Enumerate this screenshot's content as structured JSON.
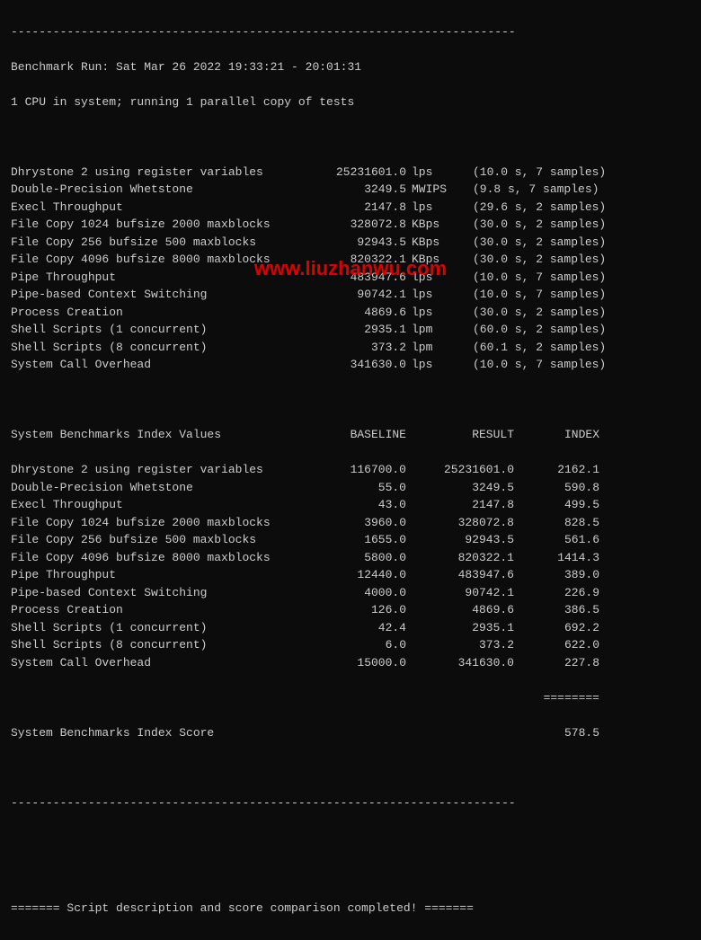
{
  "divider_top": "------------------------------------------------------------------------",
  "header": {
    "line1": "Benchmark Run: Sat Mar 26 2022 19:33:21 - 20:01:31",
    "line2": "1 CPU in system; running 1 parallel copy of tests"
  },
  "results": [
    {
      "name": "Dhrystone 2 using register variables",
      "value": "25231601.0",
      "unit": "lps",
      "note": "(10.0 s, 7 samples)"
    },
    {
      "name": "Double-Precision Whetstone",
      "value": "3249.5",
      "unit": "MWIPS",
      "note": "(9.8 s, 7 samples)"
    },
    {
      "name": "Execl Throughput",
      "value": "2147.8",
      "unit": "lps",
      "note": "(29.6 s, 2 samples)"
    },
    {
      "name": "File Copy 1024 bufsize 2000 maxblocks",
      "value": "328072.8",
      "unit": "KBps",
      "note": "(30.0 s, 2 samples)"
    },
    {
      "name": "File Copy 256 bufsize 500 maxblocks",
      "value": "92943.5",
      "unit": "KBps",
      "note": "(30.0 s, 2 samples)"
    },
    {
      "name": "File Copy 4096 bufsize 8000 maxblocks",
      "value": "820322.1",
      "unit": "KBps",
      "note": "(30.0 s, 2 samples)"
    },
    {
      "name": "Pipe Throughput",
      "value": "483947.6",
      "unit": "lps",
      "note": "(10.0 s, 7 samples)"
    },
    {
      "name": "Pipe-based Context Switching",
      "value": "90742.1",
      "unit": "lps",
      "note": "(10.0 s, 7 samples)"
    },
    {
      "name": "Process Creation",
      "value": "4869.6",
      "unit": "lps",
      "note": "(30.0 s, 2 samples)"
    },
    {
      "name": "Shell Scripts (1 concurrent)",
      "value": "2935.1",
      "unit": "lpm",
      "note": "(60.0 s, 2 samples)"
    },
    {
      "name": "Shell Scripts (8 concurrent)",
      "value": "373.2",
      "unit": "lpm",
      "note": "(60.1 s, 2 samples)"
    },
    {
      "name": "System Call Overhead",
      "value": "341630.0",
      "unit": "lps",
      "note": "(10.0 s, 7 samples)"
    }
  ],
  "index_header": {
    "name": "System Benchmarks Index Values",
    "baseline": "BASELINE",
    "result": "RESULT",
    "index": "INDEX"
  },
  "index_rows": [
    {
      "name": "Dhrystone 2 using register variables",
      "baseline": "116700.0",
      "result": "25231601.0",
      "index": "2162.1"
    },
    {
      "name": "Double-Precision Whetstone",
      "baseline": "55.0",
      "result": "3249.5",
      "index": "590.8"
    },
    {
      "name": "Execl Throughput",
      "baseline": "43.0",
      "result": "2147.8",
      "index": "499.5"
    },
    {
      "name": "File Copy 1024 bufsize 2000 maxblocks",
      "baseline": "3960.0",
      "result": "328072.8",
      "index": "828.5"
    },
    {
      "name": "File Copy 256 bufsize 500 maxblocks",
      "baseline": "1655.0",
      "result": "92943.5",
      "index": "561.6"
    },
    {
      "name": "File Copy 4096 bufsize 8000 maxblocks",
      "baseline": "5800.0",
      "result": "820322.1",
      "index": "1414.3"
    },
    {
      "name": "Pipe Throughput",
      "baseline": "12440.0",
      "result": "483947.6",
      "index": "389.0"
    },
    {
      "name": "Pipe-based Context Switching",
      "baseline": "4000.0",
      "result": "90742.1",
      "index": "226.9"
    },
    {
      "name": "Process Creation",
      "baseline": "126.0",
      "result": "4869.6",
      "index": "386.5"
    },
    {
      "name": "Shell Scripts (1 concurrent)",
      "baseline": "42.4",
      "result": "2935.1",
      "index": "692.2"
    },
    {
      "name": "Shell Scripts (8 concurrent)",
      "baseline": "6.0",
      "result": "373.2",
      "index": "622.0"
    },
    {
      "name": "System Call Overhead",
      "baseline": "15000.0",
      "result": "341630.0",
      "index": "227.8"
    }
  ],
  "score_divider": "========",
  "score": {
    "label": "System Benchmarks Index Score",
    "value": "578.5"
  },
  "divider_bottom": "------------------------------------------------------------------------",
  "footer": "======= Script description and score comparison completed! =======",
  "watermark": "www.liuzhanwu.com"
}
